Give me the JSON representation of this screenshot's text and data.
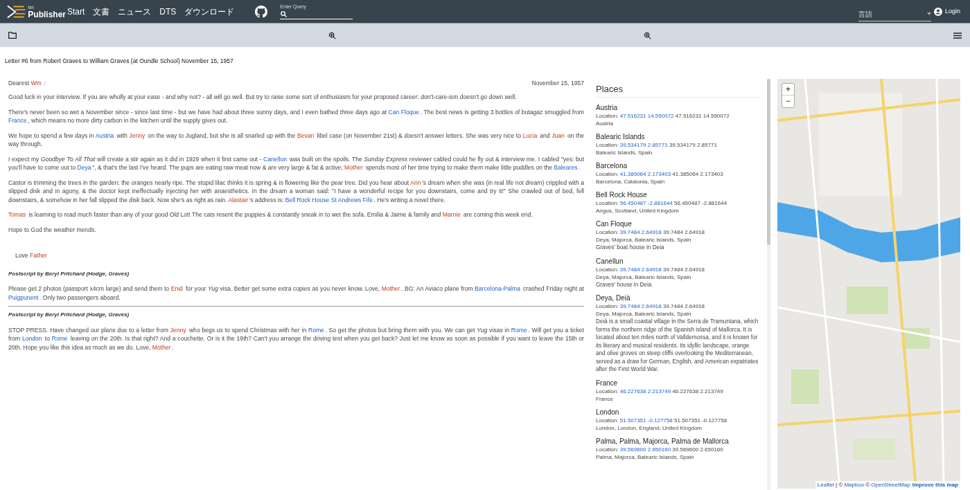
{
  "header": {
    "logo_small": "tei",
    "logo": "Publisher",
    "nav": [
      "Start",
      "文書",
      "ニュース",
      "DTS",
      "ダウンロード"
    ],
    "search": {
      "label": "Enter Query"
    },
    "language": {
      "placeholder": "言語"
    },
    "login": "Login"
  },
  "document_title": "Letter #6 from Robert Graves to William Graves (at Oundle School) November 15, 1957",
  "letter": {
    "salutation": [
      {
        "kind": "text",
        "text": "Dearest "
      },
      {
        "kind": "person",
        "text": "Wm"
      },
      {
        "kind": "text",
        "text": " :"
      }
    ],
    "date": "November 15, 1957",
    "paragraphs": [
      [
        {
          "kind": "text",
          "text": "Good luck in your interview. If you are wholly at your ease - and why not? - all will go well. But try to raise some sort of enthusiasm for your proposed career: don't-care-ism doesn't go down well."
        }
      ],
      [
        {
          "kind": "text",
          "text": "There's never been so wet a November since - since last time - but we have had about three sunny days, and I even bathed three days ago at "
        },
        {
          "kind": "place",
          "text": "Can Floque"
        },
        {
          "kind": "text",
          "text": ". The best news is getting 3 bottles of butagaz smuggled from "
        },
        {
          "kind": "place",
          "text": "France"
        },
        {
          "kind": "text",
          "text": ", which means no more dirty carbon in the kitchen until the supply gives out."
        }
      ],
      [
        {
          "kind": "text",
          "text": "We hope to spend a few days in "
        },
        {
          "kind": "place",
          "text": "Austria"
        },
        {
          "kind": "text",
          "text": " with "
        },
        {
          "kind": "person",
          "text": "Jenny"
        },
        {
          "kind": "text",
          "text": " on the way to Jugland, but she is all snarled up with the "
        },
        {
          "kind": "person",
          "text": "Bevan"
        },
        {
          "kind": "text",
          "text": " libel case (on November 21st) & doesn't answer letters. She was very nice to "
        },
        {
          "kind": "person",
          "text": "Lucia"
        },
        {
          "kind": "text",
          "text": " and "
        },
        {
          "kind": "person",
          "text": "Juan"
        },
        {
          "kind": "text",
          "text": " on the way through."
        }
      ],
      [
        {
          "kind": "text",
          "text": "I expect my "
        },
        {
          "kind": "italic",
          "text": "Goodbye To All That"
        },
        {
          "kind": "text",
          "text": " will create a stir again as it did in 1929 when it first came out - "
        },
        {
          "kind": "place",
          "text": "Canellun"
        },
        {
          "kind": "text",
          "text": " was built on the spoils. The "
        },
        {
          "kind": "italic",
          "text": "Sunday Express"
        },
        {
          "kind": "text",
          "text": " reviewer cabled could he fly out & interview me. I cabled \"yes: but you'll have to come out to "
        },
        {
          "kind": "place",
          "text": "Deya"
        },
        {
          "kind": "text",
          "text": "\", & that's the last I've heard. The pups are eating raw meat now & are very large & fat & active; "
        },
        {
          "kind": "person",
          "text": "Mother"
        },
        {
          "kind": "text",
          "text": " spends most of her time trying to make them make little puddles on the "
        },
        {
          "kind": "place",
          "text": "Baleares"
        },
        {
          "kind": "text",
          "text": "."
        }
      ],
      [
        {
          "kind": "text",
          "text": "Castor is trimming the trees in the garden: the oranges nearly ripe. The stupid lilac thinks it is spring & is flowering like the pear tree. Did you hear about "
        },
        {
          "kind": "person",
          "text": "Ann"
        },
        {
          "kind": "text",
          "text": "'s dream when she was (in real life not dream) crippled with a slipped disk and in agony, & the doctor kept ineffectually injecting her with anaesthetics. In the dream a woman said: \"I have a wonderful recipe for you downstairs, come and try it!\" She crawled out of bed, fell downstairs, & somehow in her fall slipped the disk back. Now she's as right as rain. "
        },
        {
          "kind": "person",
          "text": "Alastair"
        },
        {
          "kind": "text",
          "text": "'s address is: "
        },
        {
          "kind": "place",
          "text": "Bell Rock House St Andrews Fife"
        },
        {
          "kind": "text",
          "text": ". He's writing a novel there."
        }
      ],
      [
        {
          "kind": "person",
          "text": "Tomas"
        },
        {
          "kind": "text",
          "text": " is learning to read much faster than any of your good Old Lot! The cats resent the puppies & constantly sneak in to wet the sofa. Emilia & Jaime & family and "
        },
        {
          "kind": "person",
          "text": "Marnie"
        },
        {
          "kind": "text",
          "text": " are coming this week end."
        }
      ],
      [
        {
          "kind": "text",
          "text": "Hope to God the weather mends."
        }
      ]
    ],
    "closing": [
      {
        "kind": "text",
        "text": "Love "
      },
      {
        "kind": "person",
        "text": "Father"
      }
    ],
    "postscripts": [
      {
        "heading": "Postscript by Beryl Pritchard (Hodge, Graves)",
        "divider": true,
        "text": [
          {
            "kind": "text",
            "text": "Please get 2 photos (passport x4cm large) and send them to "
          },
          {
            "kind": "person",
            "text": "Enid"
          },
          {
            "kind": "text",
            "text": " for your "
          },
          {
            "kind": "italic",
            "text": "Yug"
          },
          {
            "kind": "text",
            "text": " visa. Better get some extra copies as you never know. Love, "
          },
          {
            "kind": "person",
            "text": "Mother"
          },
          {
            "kind": "text",
            "text": ". BG: An Aviaco plane from "
          },
          {
            "kind": "place",
            "text": "Barcelona-Palma"
          },
          {
            "kind": "text",
            "text": " crashed Friday night at "
          },
          {
            "kind": "place",
            "text": "Puigpunent"
          },
          {
            "kind": "text",
            "text": ". Only two passengers aboard."
          }
        ]
      },
      {
        "heading": "Postscript by Beryl Pritchard (Hodge, Graves)",
        "divider": false,
        "text": [
          {
            "kind": "text",
            "text": "STOP PRESS. Have changed our plans due to a letter from "
          },
          {
            "kind": "person",
            "text": "Jenny"
          },
          {
            "kind": "text",
            "text": " who begs us to spend Christmas with her in "
          },
          {
            "kind": "place",
            "text": "Rome"
          },
          {
            "kind": "text",
            "text": ". So get the photos but bring them with you. We can get "
          },
          {
            "kind": "italic",
            "text": "Yug"
          },
          {
            "kind": "text",
            "text": " visas in "
          },
          {
            "kind": "place",
            "text": "Rome"
          },
          {
            "kind": "text",
            "text": ". Will get you a ticket from "
          },
          {
            "kind": "place",
            "text": "London"
          },
          {
            "kind": "text",
            "text": " to "
          },
          {
            "kind": "place",
            "text": "Rome"
          },
          {
            "kind": "text",
            "text": " leaving on the 20th. Is that right? And a couchette. Or is it the 19th? Can't you arrange the driving test when you get back? Just let me know as soon as possible if you want to leave the 15th or 20th. Hope you like this idea as much as we do. Love, "
          },
          {
            "kind": "person",
            "text": "Mother"
          },
          {
            "kind": "text",
            "text": "."
          }
        ]
      }
    ]
  },
  "places": {
    "title": "Places",
    "items": [
      {
        "name": "Austria",
        "location_label": "Location:",
        "location_link": "47.516231 14.550072",
        "location_text": "47.516231 14.550072",
        "address": "Austria"
      },
      {
        "name": "Balearic Islands",
        "location_label": "Location:",
        "location_link": "39.534179 2.85771",
        "location_text": "39.534179 2.85771",
        "address": "Balearic Islands, Spain"
      },
      {
        "name": "Barcelona",
        "location_label": "Location:",
        "location_link": "41.385064 2.173403",
        "location_text": "41.385064 2.173403",
        "address": "Barcelona, Catalonia, Spain"
      },
      {
        "name": "Bell Rock House",
        "location_label": "Location:",
        "location_link": "56.450487 -2.881644",
        "location_text": "56.450487 -2.881644",
        "address": "Angus, Scotland, United Kingdom"
      },
      {
        "name": "Can Floque",
        "location_label": "Location:",
        "location_link": "39.7484 2.64918",
        "location_text": "39.7484 2.64918",
        "address": "Deya, Majorca, Balearic Islands, Spain",
        "description": "Graves' boat house in Deia"
      },
      {
        "name": "Canellun",
        "location_label": "Location:",
        "location_link": "39.7484 2.64918",
        "location_text": "39.7484 2.64918",
        "address": "Deya, Majorca, Balearic Islands, Spain",
        "description": "Graves' house in Deia"
      },
      {
        "name": "Deya, Deià",
        "location_label": "Location:",
        "location_link": "39.7484 2.64918",
        "location_text": "39.7484 2.64918",
        "address": "Deya, Majorca, Balearic Islands, Spain",
        "description": "Deià is a small coastal village in the Serra de Tramuntana, which forms the northern ridge of the Spanish island of Mallorca. It is located about ten miles north of Valldemossa, and it is known for its literary and musical residents. Its idyllic landscape, orange and olive groves on steep cliffs overlooking the Mediterranean, served as a draw for German, English, and American expatriates after the First World War."
      },
      {
        "name": "France",
        "location_label": "Location:",
        "location_link": "46.227638 2.213749",
        "location_text": "46.227638 2.213749",
        "address": "France"
      },
      {
        "name": "London",
        "location_label": "Location:",
        "location_link": "51.507351 -0.127758",
        "location_text": "51.507351 -0.127758",
        "address": "London, London, England, United Kingdom"
      },
      {
        "name": "Palma, Palma, Majorca, Palma de Mallorca",
        "location_label": "Location:",
        "location_link": "39.569600 2.650160",
        "location_text": "39.569600 2.650160",
        "address": "Palma, Majorca, Balearic Islands, Spain"
      }
    ]
  },
  "map": {
    "zoom_in": "+",
    "zoom_out": "−",
    "attribution": [
      {
        "kind": "link",
        "text": "Leaflet"
      },
      {
        "kind": "text",
        "text": " | © "
      },
      {
        "kind": "link",
        "text": "Mapbox"
      },
      {
        "kind": "text",
        "text": " © "
      },
      {
        "kind": "link",
        "text": "OpenStreetMap"
      },
      {
        "kind": "bold",
        "text": "Improve this map"
      }
    ]
  }
}
